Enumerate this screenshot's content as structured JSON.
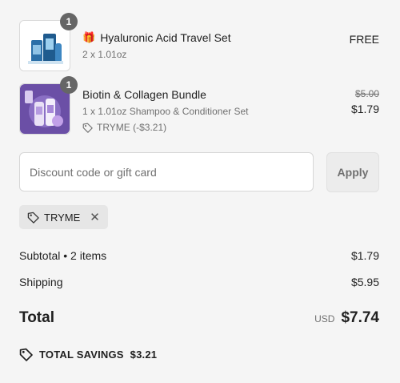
{
  "items": [
    {
      "quantity": "1",
      "gift_icon": "🎁",
      "name": "Hyaluronic Acid Travel Set",
      "variant": "2 x 1.01oz",
      "price": "FREE"
    },
    {
      "quantity": "1",
      "name": "Biotin & Collagen Bundle",
      "variant": "1 x 1.01oz Shampoo & Conditioner Set",
      "discount_line": "TRYME (-$3.21)",
      "original_price": "$5.00",
      "price": "$1.79"
    }
  ],
  "discount": {
    "placeholder": "Discount code or gift card",
    "value": "",
    "apply_label": "Apply"
  },
  "applied_code": {
    "code": "TRYME",
    "remove_glyph": "✕"
  },
  "summary": {
    "subtotal_label": "Subtotal • 2 items",
    "subtotal_value": "$1.79",
    "shipping_label": "Shipping",
    "shipping_value": "$5.95",
    "total_label": "Total",
    "currency": "USD",
    "total_value": "$7.74",
    "savings_label": "TOTAL SAVINGS",
    "savings_value": "$3.21"
  },
  "icons": {
    "tag": "tag-icon",
    "gift": "gift-icon",
    "close": "close-icon"
  },
  "colors": {
    "background": "#f5f5f5",
    "badge": "#666666",
    "thumb1_accent": "#2b6fa8",
    "thumb2_accent": "#7c5cb8"
  }
}
